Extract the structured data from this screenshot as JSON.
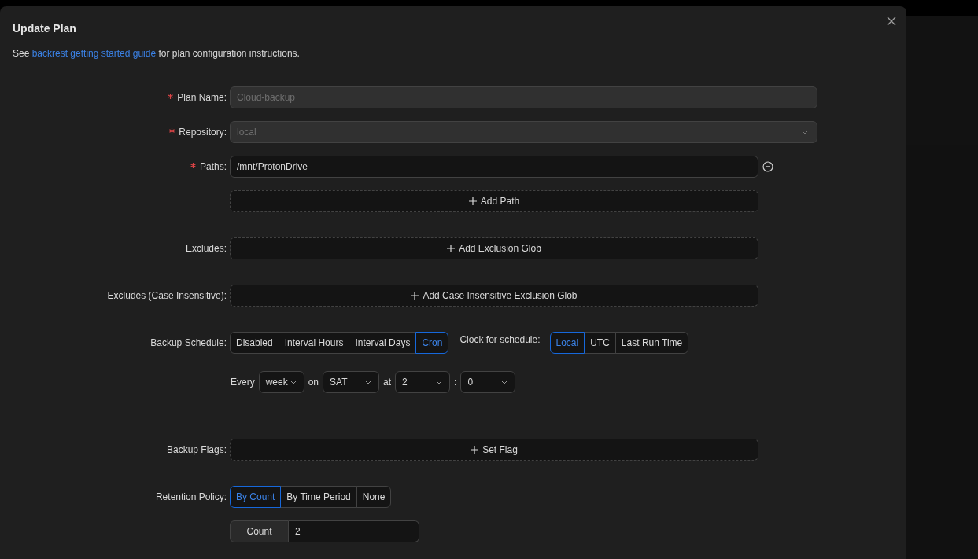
{
  "dialog": {
    "title": "Update Plan",
    "intro": {
      "before": "See",
      "link": "backrest getting started guide",
      "after": "for plan configuration instructions."
    }
  },
  "plan_name": {
    "label": "Plan Name:",
    "required": true,
    "value": "Cloud-backup",
    "disabled": true
  },
  "repository": {
    "label": "Repository:",
    "required": true,
    "value": "local",
    "disabled": true
  },
  "paths": {
    "label": "Paths:",
    "required": true,
    "values": [
      "/mnt/ProtonDrive"
    ],
    "add_button": "Add Path"
  },
  "excludes": {
    "label": "Excludes:",
    "add_button": "Add Exclusion Glob"
  },
  "excludes_ci": {
    "label": "Excludes (Case Insensitive):",
    "add_button": "Add Case Insensitive Exclusion Glob"
  },
  "schedule": {
    "label": "Backup Schedule:",
    "modes": [
      {
        "label": "Disabled",
        "selected": false
      },
      {
        "label": "Interval Hours",
        "selected": false
      },
      {
        "label": "Interval Days",
        "selected": false
      },
      {
        "label": "Cron",
        "selected": true
      }
    ],
    "clock_label": "Clock for schedule:",
    "clocks": [
      {
        "label": "Local",
        "selected": true
      },
      {
        "label": "UTC",
        "selected": false
      },
      {
        "label": "Last Run Time",
        "selected": false
      }
    ],
    "cron": [
      {
        "kind": "text",
        "text": "Every"
      },
      {
        "kind": "select",
        "value": "week"
      },
      {
        "kind": "text",
        "text": "on"
      },
      {
        "kind": "select",
        "value": "SAT"
      },
      {
        "kind": "text",
        "text": "at"
      },
      {
        "kind": "select",
        "value": "2"
      },
      {
        "kind": "text",
        "text": ":"
      },
      {
        "kind": "select",
        "value": "0"
      }
    ]
  },
  "backup_flags": {
    "label": "Backup Flags:",
    "add_button": "Set Flag"
  },
  "retention": {
    "label": "Retention Policy:",
    "modes": [
      {
        "label": "By Count",
        "selected": true
      },
      {
        "label": "By Time Period",
        "selected": false
      },
      {
        "label": "None",
        "selected": false
      }
    ],
    "count_label": "Count",
    "count_value": "2"
  }
}
